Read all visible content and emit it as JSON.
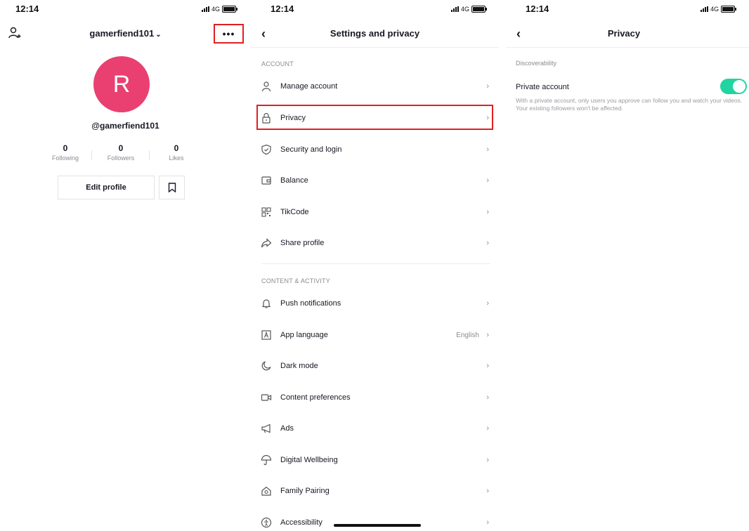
{
  "status_bar": {
    "time": "12:14",
    "network": "4G"
  },
  "profile": {
    "username": "gamerfiend101",
    "avatar_letter": "R",
    "handle": "@gamerfiend101",
    "stats": [
      {
        "value": "0",
        "label": "Following"
      },
      {
        "value": "0",
        "label": "Followers"
      },
      {
        "value": "0",
        "label": "Likes"
      }
    ],
    "more_label": "•••",
    "edit_profile_label": "Edit profile"
  },
  "settings": {
    "title": "Settings and privacy",
    "sections": [
      {
        "header": "ACCOUNT",
        "items": [
          {
            "label": "Manage account",
            "icon": "person-icon"
          },
          {
            "label": "Privacy",
            "icon": "lock-icon"
          },
          {
            "label": "Security and login",
            "icon": "shield-icon"
          },
          {
            "label": "Balance",
            "icon": "wallet-icon"
          },
          {
            "label": "TikCode",
            "icon": "qrcode-icon"
          },
          {
            "label": "Share profile",
            "icon": "share-icon"
          }
        ]
      },
      {
        "header": "CONTENT & ACTIVITY",
        "items": [
          {
            "label": "Push notifications",
            "icon": "bell-icon"
          },
          {
            "label": "App language",
            "icon": "language-icon",
            "value": "English"
          },
          {
            "label": "Dark mode",
            "icon": "moon-icon"
          },
          {
            "label": "Content preferences",
            "icon": "video-icon"
          },
          {
            "label": "Ads",
            "icon": "megaphone-icon"
          },
          {
            "label": "Digital Wellbeing",
            "icon": "umbrella-icon"
          },
          {
            "label": "Family Pairing",
            "icon": "house-icon"
          },
          {
            "label": "Accessibility",
            "icon": "accessibility-icon"
          }
        ]
      }
    ]
  },
  "privacy": {
    "title": "Privacy",
    "section": "Discoverability",
    "private_account_label": "Private account",
    "private_account_enabled": true,
    "description": "With a private account, only users you approve can follow you and watch your videos. Your existing followers won't be affected."
  },
  "colors": {
    "accent_red": "#e02020",
    "avatar": "#e94071",
    "toggle_on": "#20d5a0"
  }
}
